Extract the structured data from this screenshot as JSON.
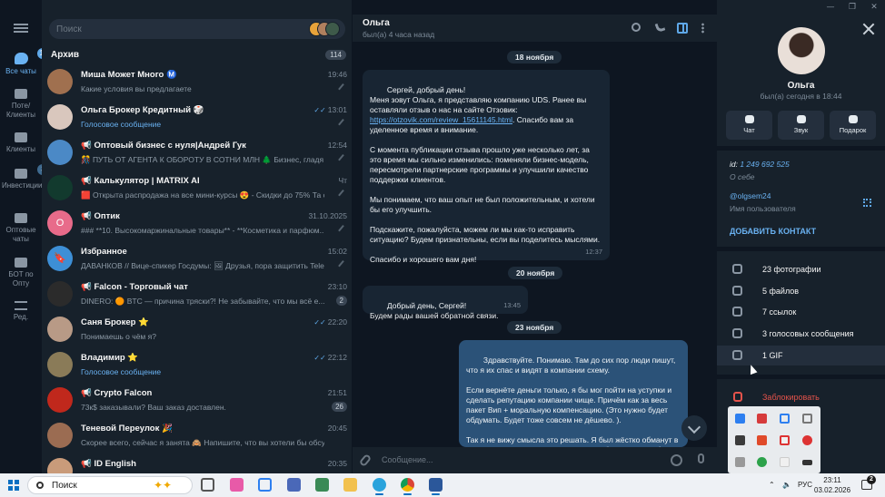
{
  "window_controls": {
    "minimize": "—",
    "restore": "❐",
    "close": "✕"
  },
  "folders": [
    {
      "label": "Все чаты",
      "badge": "13",
      "active": true
    },
    {
      "label": "Потe/Клиенты",
      "badge": ""
    },
    {
      "label": "Клиенты",
      "badge": ""
    },
    {
      "label": "Инвестиции",
      "badge": "3"
    },
    {
      "label": "Оптовые чаты",
      "badge": ""
    },
    {
      "label": "БОТ по Опту",
      "badge": ""
    },
    {
      "label": "Ред.",
      "badge": ""
    }
  ],
  "search": {
    "placeholder": "Поиск"
  },
  "archive": {
    "label": "Архив",
    "count": "114"
  },
  "chats": [
    {
      "name": "Миша Может Много Ⓜ️",
      "time": "19:46",
      "preview": "Какие условия вы предлагаете",
      "pinned": true,
      "avatar_color": "#a0704f",
      "avatar_text": ""
    },
    {
      "name": "Ольга Брокер Кредитный 🎲",
      "time": "13:01",
      "read": true,
      "preview": "Голосовое сообщение",
      "preview_blue": true,
      "pinned": true,
      "avatar_color": "#d9c7bd",
      "avatar_text": ""
    },
    {
      "name": "📢 Оптовый бизнес с нуля|Андрей Гук",
      "time": "12:54",
      "preview": "🎊 ПУТЬ ОТ АГЕНТА К ОБОРОТУ В СОТНИ МЛН 🌲 Бизнес, гладя на ...",
      "pinned": true,
      "avatar_color": "#4b89c6",
      "avatar_text": ""
    },
    {
      "name": "📢 Калькулятор | MATRIX AI",
      "time": "Чт",
      "preview": "🟥 Открыта распродажа на все мини-курсы 😍 - Скидки до 75% Та с...",
      "pinned": true,
      "avatar_color": "#123a2e",
      "avatar_text": ""
    },
    {
      "name": "📢 Оптик",
      "time": "31.10.2025",
      "preview": "### **10. Высокомаржинальные товары** - **Косметика и парфюм...",
      "pinned": true,
      "avatar_color": "#e86b8a",
      "avatar_text": "О"
    },
    {
      "name": "Избранное",
      "time": "15:02",
      "preview": "ДАВАНКОВ // Вице-спикер Госдумы: 🖼 Друзья, пора защитить Teleg...",
      "preview_blue_prefix": true,
      "pinned": true,
      "avatar_color": "#3d8fd6",
      "avatar_text": "🔖"
    },
    {
      "name": "📢 Falcon - Торговый чат",
      "time": "23:10",
      "preview": "DINERO: 🟠 BTC — причина тряски?! Не забывайте, что мы всё е...",
      "count": "2",
      "avatar_color": "#2b2b2b",
      "avatar_text": ""
    },
    {
      "name": "Саня Брокер ⭐",
      "time": "22:20",
      "read": true,
      "preview": "Понимаешь о чём я?",
      "avatar_color": "#b89a86",
      "avatar_text": ""
    },
    {
      "name": "Владимир ⭐",
      "time": "22:12",
      "read": true,
      "preview": "Голосовое сообщение",
      "preview_blue": true,
      "avatar_color": "#8a7b58",
      "avatar_text": ""
    },
    {
      "name": "📢 Crypto Falcon",
      "time": "21:51",
      "preview": "73к$ заказывали? Ваш заказ доставлен.",
      "count": "26",
      "avatar_color": "#c0281c",
      "avatar_text": ""
    },
    {
      "name": "Теневой Переулок 🎉",
      "time": "20:45",
      "preview": "Скорее всего, сейчас я занята 🙈 Напишите, что вы хотели бы обсудить,...",
      "avatar_color": "#9b6c52",
      "avatar_text": ""
    },
    {
      "name": "📢 ID English",
      "time": "20:35",
      "preview": "",
      "avatar_color": "#c99b7a",
      "avatar_text": ""
    }
  ],
  "chat": {
    "name": "Ольга",
    "status": "был(а) 4 часа назад",
    "composer_placeholder": "Сообщение...",
    "dates": [
      "18 ноября",
      "20 ноября",
      "23 ноября"
    ],
    "messages": [
      {
        "dir": "in",
        "time": "12:37",
        "parts": [
          "Сергей, добрый день!\nМеня зовут Ольга, я представляю компанию UDS. Ранее вы оставляли отзыв о нас на сайте Отзовик: ",
          "https://otzovik.com/review_15611145.html",
          ". Спасибо вам за уделенное время и внимание.\n\nС момента публикации отзыва прошло уже несколько лет, за это время мы сильно изменились: поменяли бизнес-модель, пересмотрели партнерские программы и улучшили качество поддержки клиентов.\n\nМы понимаем, что ваш опыт не был положительным, и хотели бы его улучшить.\n\nПодскажите, пожалуйста, можем ли мы как-то исправить ситуацию? Будем признательны, если вы поделитесь мыслями.\n\nСпасибо и хорошего вам дня!"
        ]
      },
      {
        "dir": "in",
        "time": "13:45",
        "text": "Добрый день, Сергей!\nБудем рады вашей обратной связи."
      },
      {
        "dir": "out",
        "time": "",
        "text": "Здравствуйте. Понимаю. Там до сих пор люди пишут, что я их спас и видят в компании схему.\n\nЕсли вернёте деньги только, я бы мог пойти на уступки и сделать репутацию компании чище. Причём как за весь пакет Вип + моральную компенсацию. (Это нужно будет обдумать. Будет тоже совсем не дёшево. ).\n\nТак я не вижу смысла это решать. Я был жёстко обманут в св... довольно юном возрасте, когда я был очень слаб. Я даже в..."
      }
    ]
  },
  "profile": {
    "name": "Ольга",
    "status": "был(а) сегодня в 18:44",
    "buttons": [
      "Чат",
      "Звук",
      "Подарок"
    ],
    "id_prefix": "id: ",
    "id_value": "1 249 692 525",
    "about_label": "О себе",
    "username": "@olgsem24",
    "username_label": "Имя пользователя",
    "add_contact": "ДОБАВИТЬ КОНТАКТ",
    "media": [
      "23 фотографии",
      "5 файлов",
      "7 ссылок",
      "3 голосовых сообщения",
      "1 GIF"
    ],
    "block": "Заблокировать"
  },
  "taskbar": {
    "search_label": "Поиск",
    "lang": "РУС",
    "time": "23:11",
    "date": "03.02.2026",
    "notifications": "2"
  },
  "colors": {
    "accent": "#5fa8e8",
    "outgoing_bubble": "#2b5278",
    "incoming_bubble": "#182533",
    "danger": "#e5534b"
  }
}
